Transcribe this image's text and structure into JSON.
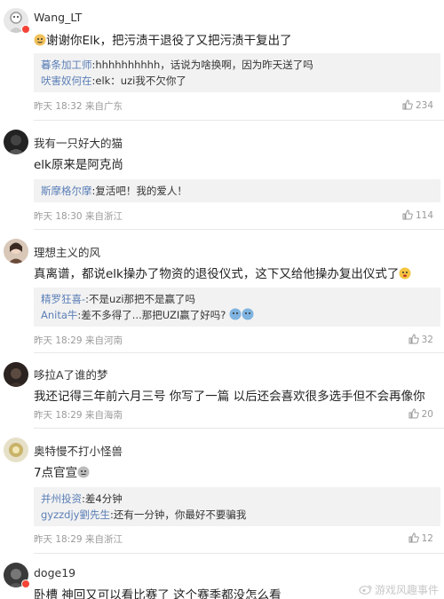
{
  "comments": [
    {
      "username": "Wang_LT",
      "text": "谢谢你Elk，把污渍干退役了又把污渍干复出了",
      "replies": [
        {
          "name": "暮条加工师",
          "text": ":hhhhhhhhhh，话说为啥换啊，因为昨天送了吗"
        },
        {
          "name": "吠害奴何在",
          "text": ":elk：uzi我不欠你了"
        }
      ],
      "time": "昨天 18:32",
      "location": "来自广东",
      "likes": "234"
    },
    {
      "username": "我有一只好大的猫",
      "text": "elk原来是阿克尚",
      "replies": [
        {
          "name": "斯摩格尔摩",
          "text": ":复活吧！我的爱人！"
        }
      ],
      "time": "昨天 18:30",
      "location": "来自浙江",
      "likes": "114"
    },
    {
      "username": "理想主义的风",
      "text": "真离谱，都说elk操办了物资的退役仪式，这下又给他操办复出仪式了",
      "replies": [
        {
          "name": "精罗狂喜-",
          "text": ":不是uzi那把不是赢了吗"
        },
        {
          "name": "Anita牛",
          "text": ":差不多得了...那把UZI赢了好吗?"
        }
      ],
      "time": "昨天 18:29",
      "location": "来自河南",
      "likes": "32"
    },
    {
      "username": "哆拉A了谁的梦",
      "text": "我还记得三年前六月三号 你写了一篇 以后还会喜欢很多选手但不会再像你",
      "replies": [],
      "time": "昨天 18:29",
      "location": "来自海南",
      "likes": "20"
    },
    {
      "username": "奥特慢不打小怪兽",
      "text": "7点官宣",
      "replies": [
        {
          "name": "并州投资",
          "text": ":差4分钟"
        },
        {
          "name": "gyzzdjy劉先生",
          "text": ":还有一分钟，你最好不要骗我"
        }
      ],
      "time": "昨天 18:29",
      "location": "来自浙江",
      "likes": "12"
    },
    {
      "username": "doge19",
      "text": "卧槽 神回又可以看比赛了 这个赛季都没怎么看",
      "replies": [],
      "time": "",
      "location": "",
      "likes": ""
    }
  ],
  "watermark": "游戏风趣事件",
  "icons": {
    "like": "thumbs-up-icon",
    "verified": "verified-badge-icon",
    "weibo": "weibo-logo-icon"
  },
  "colors": {
    "reply_name": "#5b7fb7",
    "meta": "#9a9a9a",
    "reply_bg": "#f2f2f2",
    "badge": "#f44336"
  }
}
